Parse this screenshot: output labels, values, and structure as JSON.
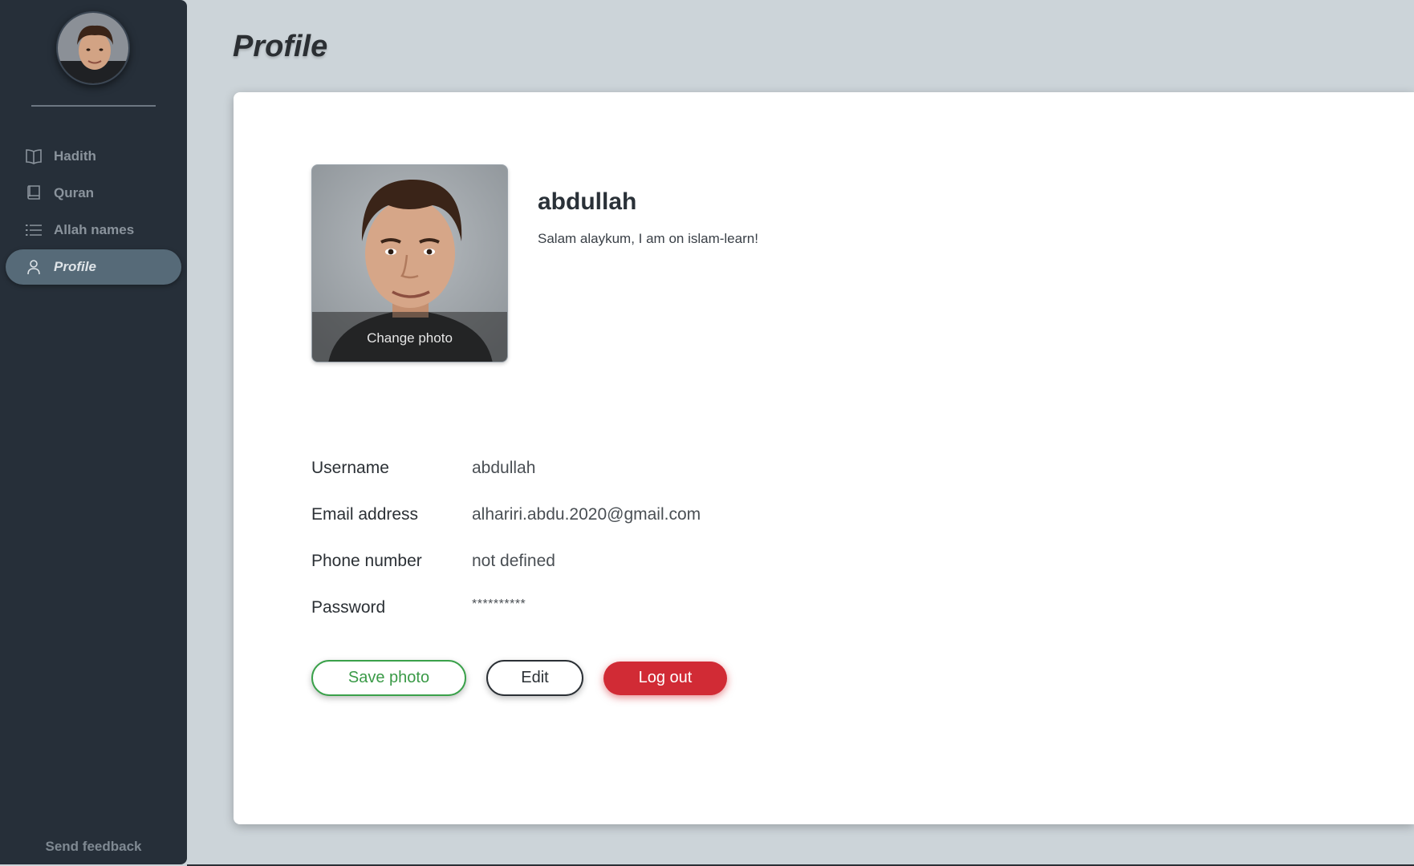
{
  "page": {
    "title": "Profile"
  },
  "sidebar": {
    "items": [
      {
        "label": "Hadith",
        "icon": "book-open-icon",
        "active": false
      },
      {
        "label": "Quran",
        "icon": "book-icon",
        "active": false
      },
      {
        "label": "Allah names",
        "icon": "list-icon",
        "active": false
      },
      {
        "label": "Profile",
        "icon": "user-icon",
        "active": true
      }
    ],
    "feedback_label": "Send feedback"
  },
  "profile": {
    "name": "abdullah",
    "bio": "Salam alaykum, I am on islam-learn!",
    "change_photo_label": "Change photo",
    "fields": [
      {
        "label": "Username",
        "value": "abdullah"
      },
      {
        "label": "Email address",
        "value": "alhariri.abdu.2020@gmail.com"
      },
      {
        "label": "Phone number",
        "value": "not defined"
      },
      {
        "label": "Password",
        "value": "**********"
      }
    ]
  },
  "buttons": {
    "save_photo": "Save photo",
    "edit": "Edit",
    "logout": "Log out"
  },
  "colors": {
    "sidebar_bg": "#262f39",
    "active_item_bg": "#566a78",
    "page_bg": "#ccd4d9",
    "save_green": "#3aa14a",
    "logout_red": "#d12b35"
  }
}
